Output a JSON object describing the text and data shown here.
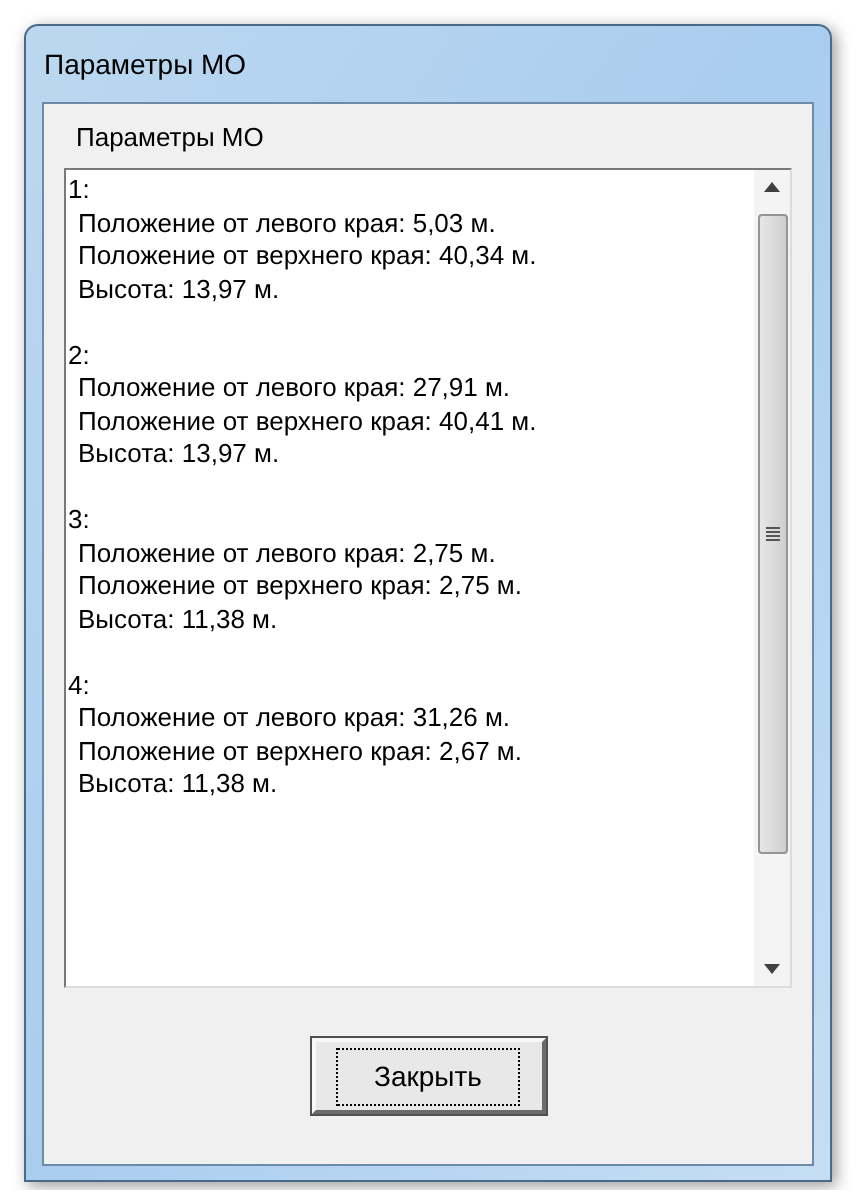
{
  "window": {
    "title": "Параметры МО"
  },
  "panel": {
    "label": "Параметры МО",
    "entries": [
      {
        "header": "1:",
        "lines": [
          "Положение от левого края: 5,03 м.",
          "Положение от верхнего края: 40,34 м.",
          "Высота: 13,97 м."
        ]
      },
      {
        "header": "2:",
        "lines": [
          "Положение от левого края: 27,91 м.",
          "Положение от верхнего края: 40,41 м.",
          "Высота: 13,97 м."
        ]
      },
      {
        "header": "3:",
        "lines": [
          "Положение от левого края: 2,75 м.",
          "Положение от верхнего края: 2,75 м.",
          "Высота: 11,38 м."
        ]
      },
      {
        "header": "4:",
        "lines": [
          "Положение от левого края: 31,26 м.",
          "Положение от верхнего края: 2,67 м.",
          "Высота: 11,38 м."
        ]
      }
    ]
  },
  "close_button": {
    "label": "Закрыть"
  }
}
